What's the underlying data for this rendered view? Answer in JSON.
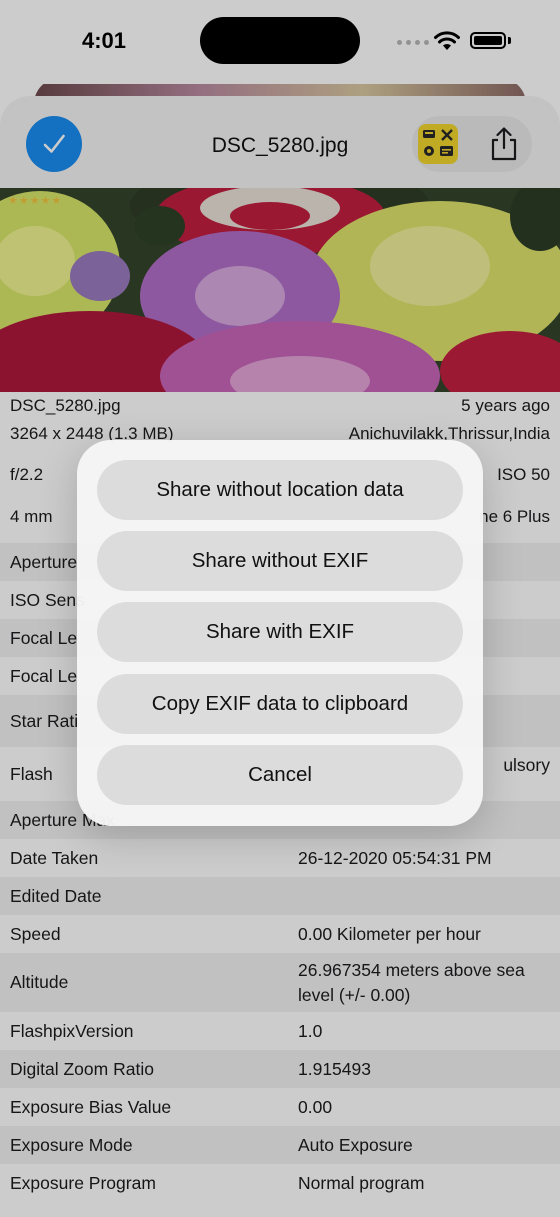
{
  "status": {
    "time": "4:01"
  },
  "header": {
    "file_name": "DSC_5280.jpg",
    "icons": {
      "select": "checkmark-icon",
      "exif": "exif-app-icon",
      "share": "share-icon"
    }
  },
  "photo": {
    "rating_stars": "★★★★★"
  },
  "info": {
    "file_name": "DSC_5280.jpg",
    "age": "5 years ago",
    "dimensions": "3264 x 2448 (1.3 MB)",
    "location": "Anichuvilakk,Thrissur,India",
    "aperture": "f/2.2",
    "iso": "ISO 50",
    "focal": "4 mm",
    "device": "ne 6 Plus"
  },
  "table": {
    "rows": [
      {
        "label": "Aperture",
        "value": ""
      },
      {
        "label": "ISO Sens",
        "value": ""
      },
      {
        "label": "Focal Le",
        "value": ""
      },
      {
        "label": "Focal Le",
        "value": ""
      },
      {
        "label": "Star Rati",
        "value": "★★★★★"
      },
      {
        "label": "Flash",
        "value": "ulsory"
      },
      {
        "label": "Aperture Max",
        "value": ""
      },
      {
        "label": "Date Taken",
        "value": "26-12-2020 05:54:31 PM"
      },
      {
        "label": "Edited Date",
        "value": ""
      },
      {
        "label": "Speed",
        "value": "0.00 Kilometer per hour"
      },
      {
        "label": "Altitude",
        "value": "26.967354 meters above sea level (+/- 0.00)"
      },
      {
        "label": "FlashpixVersion",
        "value": "1.0"
      },
      {
        "label": "Digital Zoom Ratio",
        "value": "1.915493"
      },
      {
        "label": "Exposure Bias Value",
        "value": "0.00"
      },
      {
        "label": "Exposure Mode",
        "value": "Auto Exposure"
      },
      {
        "label": "Exposure Program",
        "value": "Normal program"
      }
    ]
  },
  "sheet": {
    "share_without_location": "Share without location data",
    "share_without_exif": "Share without EXIF",
    "share_with_exif": "Share with EXIF",
    "copy_exif": "Copy EXIF data to clipboard",
    "cancel": "Cancel"
  },
  "colors": {
    "accent": "#1a8cf0",
    "star": "#f2c640",
    "exif_icon_bg": "#f3d62e"
  }
}
